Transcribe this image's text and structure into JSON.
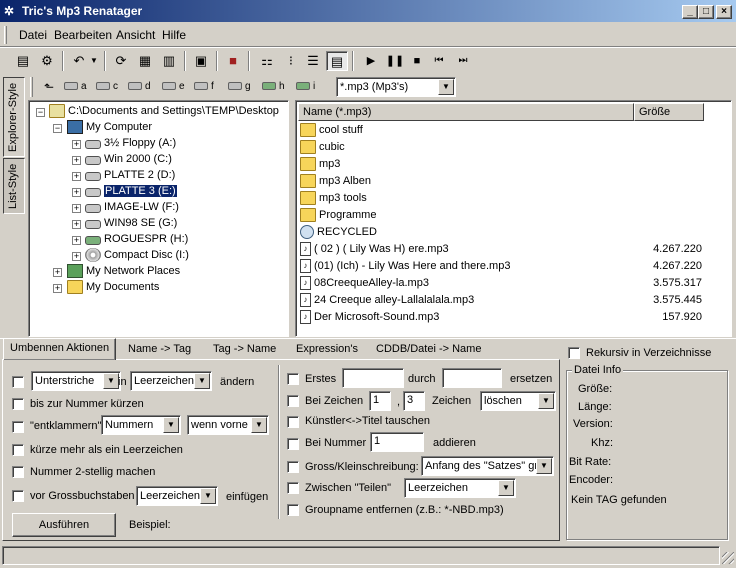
{
  "window": {
    "title": "Tric's Mp3 Renatager"
  },
  "menu": [
    {
      "label": "Datei"
    },
    {
      "label": "Bearbeiten"
    },
    {
      "label": "Ansicht"
    },
    {
      "label": "Hilfe"
    }
  ],
  "drives": [
    "a",
    "c",
    "d",
    "e",
    "f",
    "g",
    "h",
    "i"
  ],
  "filter": {
    "value": "*.mp3 (Mp3's)"
  },
  "side_tabs": {
    "explorer": "Explorer-Style",
    "list": "List-Style"
  },
  "tree": [
    {
      "label": "C:\\Documents and Settings\\TEMP\\Desktop",
      "icon": "desktop-icon"
    },
    {
      "label": "My Computer",
      "icon": "computer-icon"
    },
    {
      "label": "3½ Floppy (A:)",
      "icon": "floppy-icon"
    },
    {
      "label": "Win 2000 (C:)",
      "icon": "drive-icon"
    },
    {
      "label": "PLATTE 2 (D:)",
      "icon": "drive-icon"
    },
    {
      "label": "PLATTE 3 (E:)",
      "icon": "drive-icon",
      "selected": true
    },
    {
      "label": "IMAGE-LW (F:)",
      "icon": "drive-icon"
    },
    {
      "label": "WIN98 SE (G:)",
      "icon": "drive-icon"
    },
    {
      "label": "ROGUESPR (H:)",
      "icon": "network-drive-icon"
    },
    {
      "label": "Compact Disc (I:)",
      "icon": "cd-icon"
    },
    {
      "label": "My Network Places",
      "icon": "network-icon"
    },
    {
      "label": "My Documents",
      "icon": "folder-icon"
    }
  ],
  "filelist": {
    "col_name": "Name (*.mp3)",
    "col_size": "Größe",
    "items": [
      {
        "name": "cool stuff",
        "size": "",
        "icon": "folder-icon"
      },
      {
        "name": "cubic",
        "size": "",
        "icon": "folder-icon"
      },
      {
        "name": "mp3",
        "size": "",
        "icon": "folder-icon"
      },
      {
        "name": "mp3 Alben",
        "size": "",
        "icon": "folder-icon"
      },
      {
        "name": "mp3 tools",
        "size": "",
        "icon": "folder-icon"
      },
      {
        "name": "Programme",
        "size": "",
        "icon": "folder-icon"
      },
      {
        "name": "RECYCLED",
        "size": "",
        "icon": "recycle-bin-icon"
      },
      {
        "name": "( 02 ) ( Lily Was H) ere.mp3",
        "size": "4.267.220",
        "icon": "audio-file-icon"
      },
      {
        "name": "(01) (Ich) - Lily Was Here and there.mp3",
        "size": "4.267.220",
        "icon": "audio-file-icon"
      },
      {
        "name": "08CreequeAlley-la.mp3",
        "size": "3.575.317",
        "icon": "audio-file-icon"
      },
      {
        "name": "24 Creeque alley-Lallalalala.mp3",
        "size": "3.575.445",
        "icon": "audio-file-icon"
      },
      {
        "name": "Der Microsoft-Sound.mp3",
        "size": "157.920",
        "icon": "audio-file-icon"
      }
    ]
  },
  "tabs": [
    "Umbennen Aktionen",
    "Name -> Tag",
    "Tag -> Name",
    "Expression's",
    "CDDB/Datei -> Name"
  ],
  "left": {
    "replace_combo": "Unterstriche",
    "in_label": "in",
    "with_combo": "Leerzeichen",
    "aendern": "ändern",
    "bis_zur_nummer": "bis zur Nummer kürzen",
    "entklammern": "\"entklammern\"",
    "entklammern_combo": "Nummern",
    "wenn_combo": "wenn vorne",
    "kuerze": "kürze mehr als ein Leerzeichen",
    "nummer2": "Nummer 2-stellig machen",
    "vor_gross": "vor Grossbuchstaben",
    "vor_gross_combo": "Leerzeichen",
    "einfuegen": "einfügen",
    "run_button": "Ausführen",
    "beispiel": "Beispiel:"
  },
  "middle": {
    "erstes": "Erstes",
    "durch": "durch",
    "ersetzen": "ersetzen",
    "erstes_val": "",
    "durch_val": "",
    "bei_zeichen": "Bei Zeichen",
    "bz_a": "1",
    "comma": ",",
    "bz_b": "3",
    "zeichen": "Zeichen",
    "zeichen_combo": "löschen",
    "kuenstler": "Künstler<->Titel tauschen",
    "bei_nummer": "Bei Nummer",
    "bn_val": "1",
    "addieren": "addieren",
    "gross": "Gross/Kleinschreibung:",
    "gross_combo": "Anfang des \"Satzes\" gr",
    "zwischen": "Zwischen \"Teilen\"",
    "zwischen_combo": "Leerzeichen",
    "groupname": "Groupname entfernen (z.B.: *-NBD.mp3)"
  },
  "right": {
    "rekursiv": "Rekursiv in Verzeichnisse",
    "info_title": "Datei Info",
    "fields": [
      "Größe:",
      "Länge:",
      "Version:",
      "Khz:",
      "Bit Rate:",
      "Encoder:"
    ],
    "no_tag": "Kein TAG gefunden"
  }
}
